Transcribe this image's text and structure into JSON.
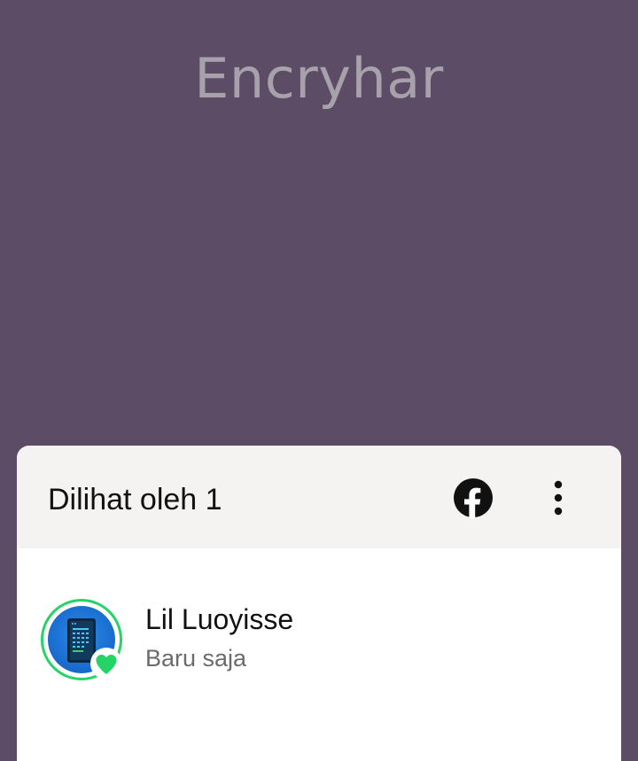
{
  "background_text": "Encryhar",
  "sheet": {
    "title": "Dilihat oleh 1",
    "facebook_icon": "facebook-icon",
    "menu_icon": "more-vert-icon"
  },
  "viewers": [
    {
      "name": "Lil Luoyisse",
      "time": "Baru saja",
      "reaction_icon": "heart-icon",
      "reaction_color": "#25d366"
    }
  ],
  "colors": {
    "background": "#5d4c66",
    "header": "#f5f3f2",
    "accent_green": "#25d366"
  }
}
